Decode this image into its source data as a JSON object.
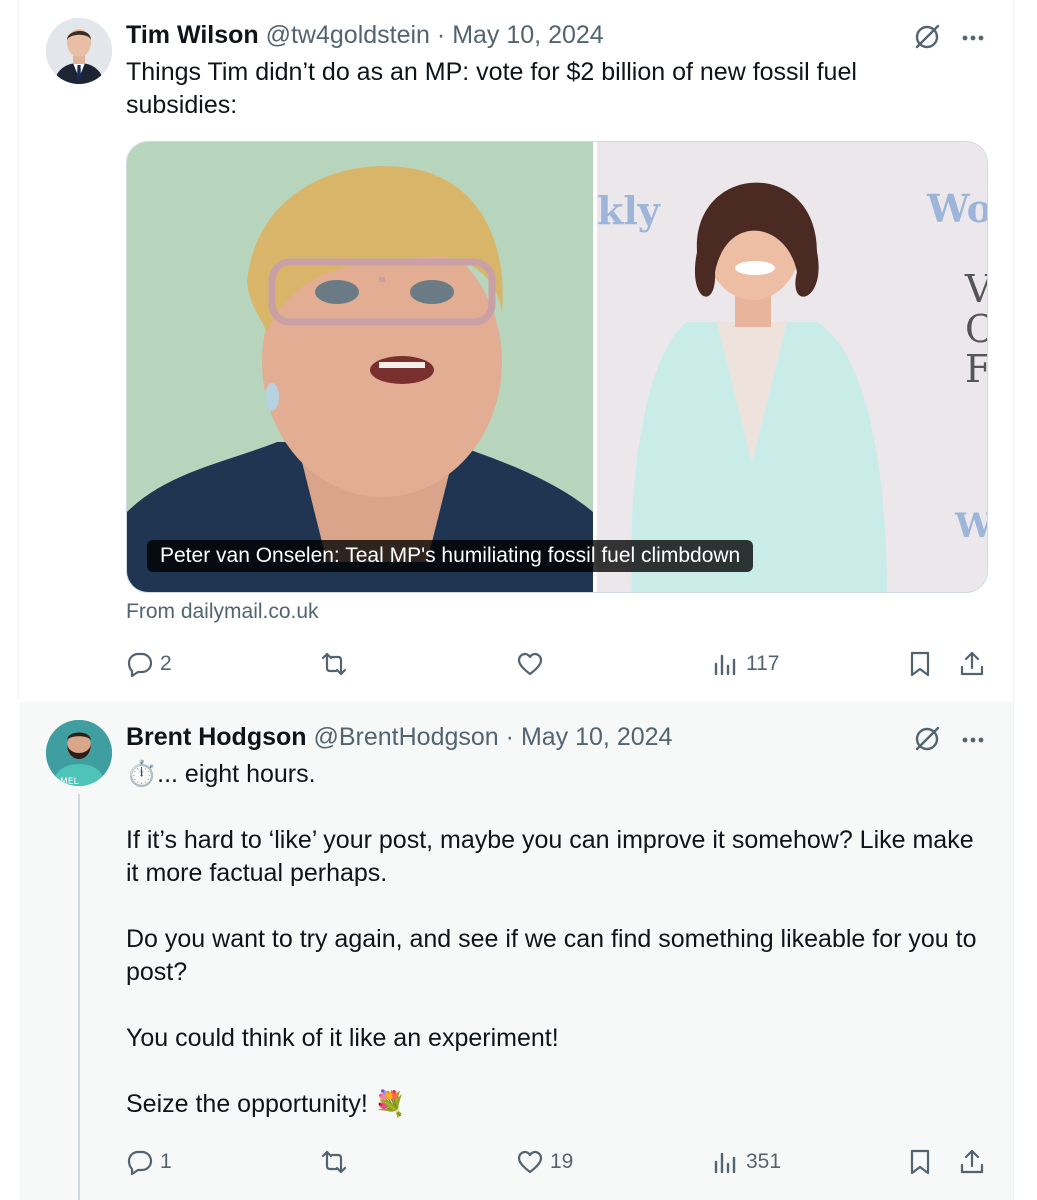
{
  "tweets": [
    {
      "author_name": "Tim Wilson",
      "author_handle": "@tw4goldstein",
      "separator": "·",
      "date": "May 10, 2024",
      "text_lines": [
        "Things Tim didn’t do as an MP: vote for $2 billion of new fossil fuel subsidies:"
      ],
      "card": {
        "caption": "Peter van Onselen: Teal MP's humiliating fossil fuel climbdown",
        "source": "From dailymail.co.uk"
      },
      "stats": {
        "replies": "2",
        "reposts": "",
        "likes": "",
        "views": "117"
      }
    },
    {
      "author_name": "Brent Hodgson",
      "author_handle": "@BrentHodgson",
      "separator": "·",
      "date": "May 10, 2024",
      "text_first": "⏱️... eight hours.",
      "paragraphs": [
        "If it’s hard to ‘like’ your post, maybe you can improve it somehow? Like make it more factual perhaps.",
        "Do you want to try again, and see if we can find something likeable for you to post?",
        "You could think of it like an experiment!",
        "Seize the opportunity! 💐"
      ],
      "stats": {
        "replies": "1",
        "reposts": "",
        "likes": "19",
        "views": "351"
      }
    }
  ],
  "icons": {
    "reply": "reply-icon",
    "repost": "repost-icon",
    "like": "heart-icon",
    "views": "views-icon",
    "bookmark": "bookmark-icon",
    "share": "share-icon",
    "grok": "grok-icon",
    "more": "more-icon"
  },
  "colors": {
    "text": "#0f1419",
    "secondary": "#536471",
    "border": "#cfd9de",
    "reply_bg": "#f7f9f9",
    "caption_bg": "#000000"
  }
}
